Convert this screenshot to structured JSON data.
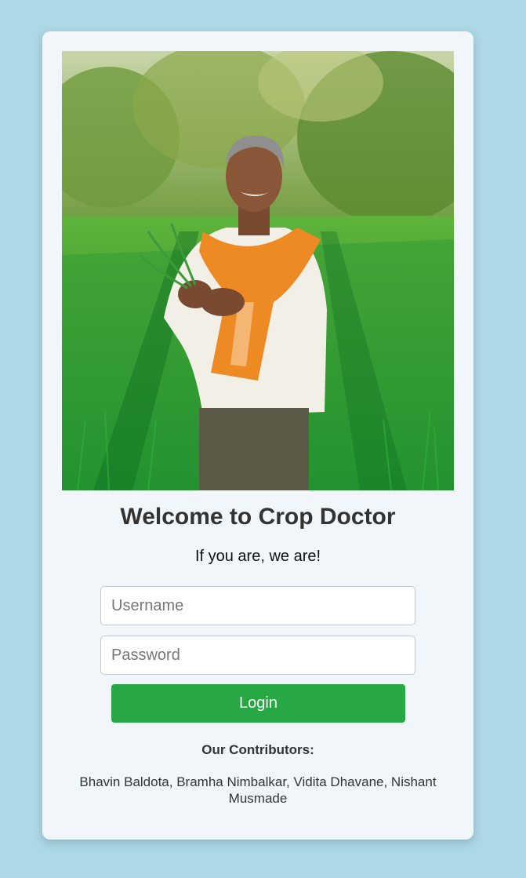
{
  "page": {
    "title": "Welcome to Crop Doctor",
    "tagline": "If you are, we are!"
  },
  "hero_image": {
    "subject": "farmer in green wheat field holding crop sprigs",
    "icon": "hero-photo"
  },
  "form": {
    "username_placeholder": "Username",
    "password_placeholder": "Password",
    "login_label": "Login"
  },
  "contributors": {
    "heading": "Our Contributors:",
    "names": "Bhavin Baldota, Bramha Nimbalkar, Vidita Dhavane, Nishant Musmade"
  },
  "colors": {
    "background": "#add8e6",
    "card": "#f0f6fa",
    "login_button": "#28a745",
    "title_text": "#333333"
  }
}
